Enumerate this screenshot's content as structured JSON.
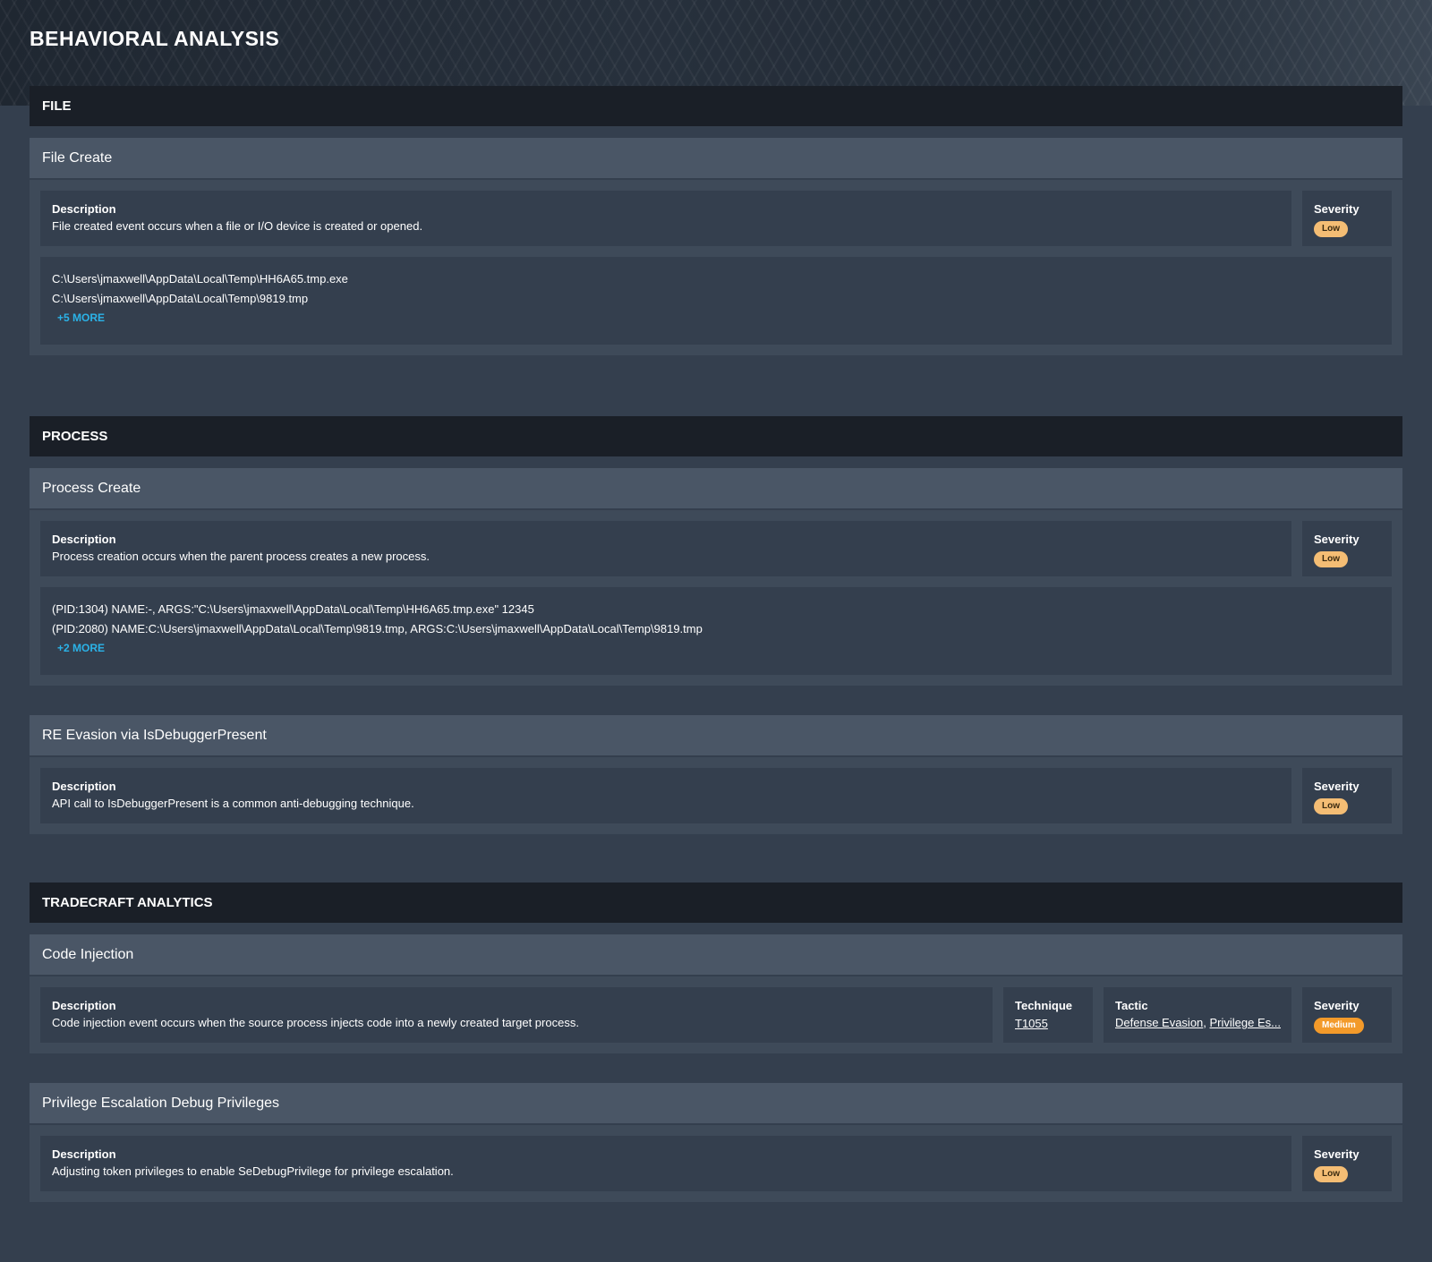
{
  "page": {
    "title": "BEHAVIORAL ANALYSIS"
  },
  "labels": {
    "description": "Description",
    "severity": "Severity",
    "technique": "Technique",
    "tactic": "Tactic"
  },
  "sections": {
    "file": {
      "header": "FILE",
      "file_create": {
        "title": "File Create",
        "description": "File created event occurs when a file or I/O device is created or opened.",
        "severity": "Low",
        "items": [
          "C:\\Users\\jmaxwell\\AppData\\Local\\Temp\\HH6A65.tmp.exe",
          "C:\\Users\\jmaxwell\\AppData\\Local\\Temp\\9819.tmp"
        ],
        "more": "+5 MORE"
      }
    },
    "process": {
      "header": "PROCESS",
      "process_create": {
        "title": "Process Create",
        "description": "Process creation occurs when the parent process creates a new process.",
        "severity": "Low",
        "items": [
          "(PID:1304) NAME:-, ARGS:\"C:\\Users\\jmaxwell\\AppData\\Local\\Temp\\HH6A65.tmp.exe\" 12345",
          "(PID:2080) NAME:C:\\Users\\jmaxwell\\AppData\\Local\\Temp\\9819.tmp, ARGS:C:\\Users\\jmaxwell\\AppData\\Local\\Temp\\9819.tmp"
        ],
        "more": "+2 MORE"
      },
      "re_evasion": {
        "title": "RE Evasion via IsDebuggerPresent",
        "description": "API call to IsDebuggerPresent is a common anti-debugging technique.",
        "severity": "Low"
      }
    },
    "tradecraft": {
      "header": "TRADECRAFT ANALYTICS",
      "code_injection": {
        "title": "Code Injection",
        "description": "Code injection event occurs when the source process injects code into a newly created target process.",
        "technique": "T1055",
        "tactics": [
          "Defense Evasion",
          "Privilege Es..."
        ],
        "tactic_separator": ", ",
        "severity": "Medium"
      },
      "priv_escalation": {
        "title": "Privilege Escalation Debug Privileges",
        "description": "Adjusting token privileges to enable SeDebugPrivilege for privilege escalation.",
        "severity": "Low"
      }
    }
  },
  "colors": {
    "severity_low": "#f4bd74",
    "severity_medium": "#f39a2a",
    "more_link": "#2bb3e8"
  }
}
